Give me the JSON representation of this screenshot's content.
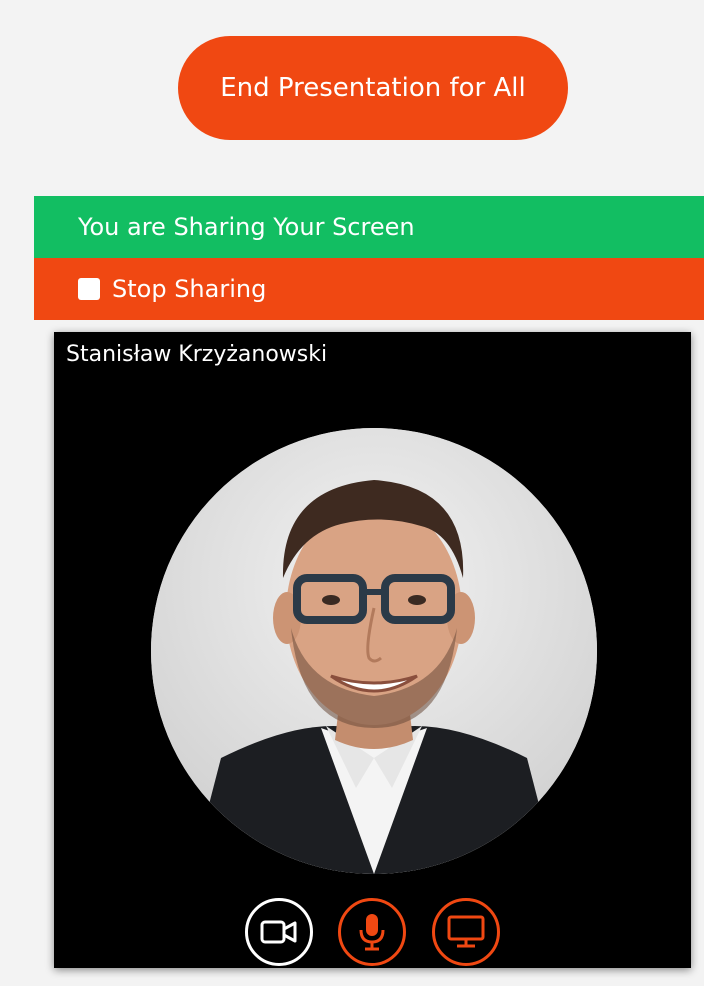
{
  "header": {
    "end_button_label": "End Presentation for All"
  },
  "sharing": {
    "status_text": "You are Sharing Your Screen",
    "stop_label": "Stop Sharing"
  },
  "participant": {
    "name": "Stanisław Krzyżanowski",
    "controls": [
      {
        "icon": "video-camera-icon",
        "state": "on",
        "color": "#ffffff"
      },
      {
        "icon": "microphone-icon",
        "state": "muted",
        "color": "#f04812"
      },
      {
        "icon": "screen-share-icon",
        "state": "active",
        "color": "#f04812"
      }
    ]
  },
  "colors": {
    "accent_red": "#f04812",
    "sharing_green": "#12be62",
    "tile_background": "#000000"
  }
}
